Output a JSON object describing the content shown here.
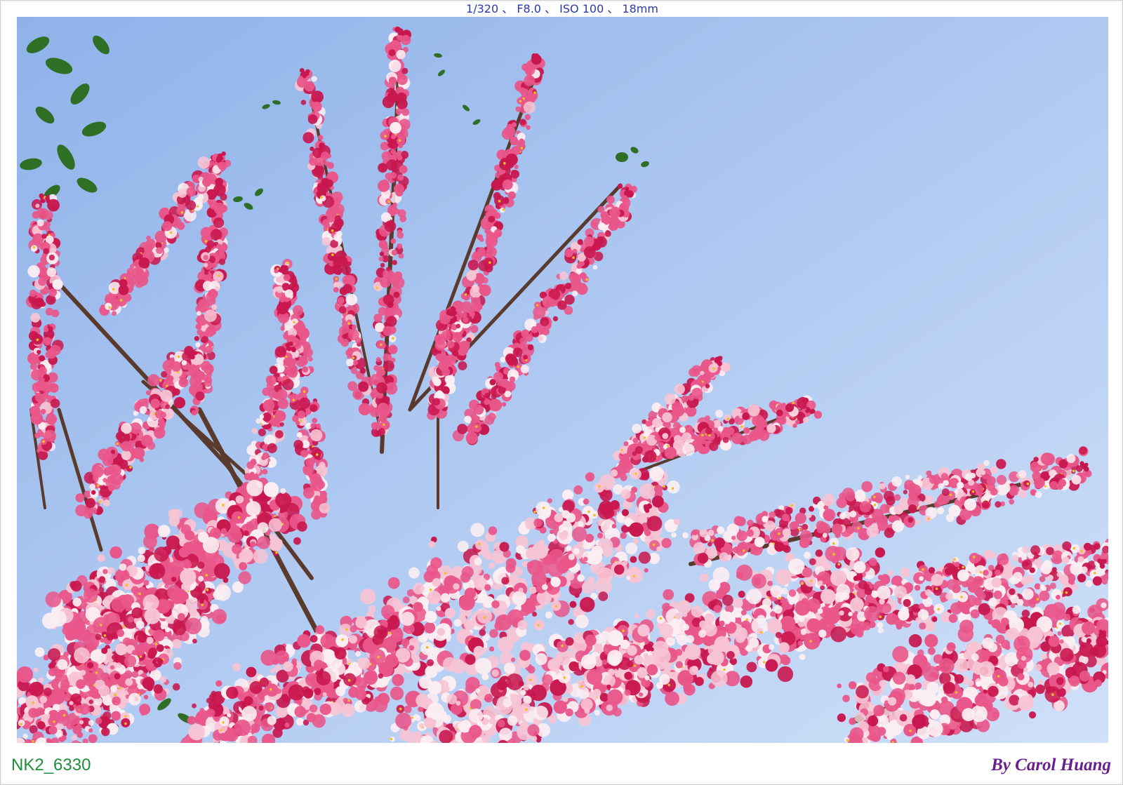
{
  "exif_line": "1/320 、 F8.0 、 ISO 100 、 18mm",
  "file_id": "NK2_6330",
  "credit": "By Carol Huang",
  "photo": {
    "subject": "pink cassia blossoms against a clear blue sky",
    "colors": {
      "sky_top": "#8fb2ea",
      "sky_bottom": "#c8dcf7",
      "blossom_deep": "#c8174e",
      "blossom_pink": "#e9568a",
      "blossom_light": "#f7c4d4",
      "blossom_white": "#fbeef2",
      "stamen": "#f0c020",
      "branch": "#5a3a2c",
      "leaf": "#2f6e25"
    }
  }
}
